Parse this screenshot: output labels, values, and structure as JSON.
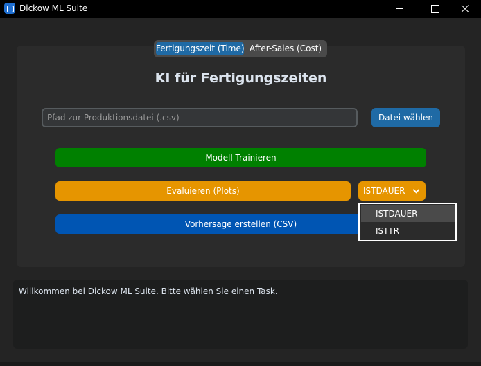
{
  "window": {
    "title": "Dickow ML Suite",
    "icon": "app-window-icon"
  },
  "tabs": [
    {
      "label": "Fertigungszeit (Time)",
      "selected": true
    },
    {
      "label": "After-Sales (Cost)",
      "selected": false
    }
  ],
  "main": {
    "title": "KI für Fertigungszeiten",
    "file_input": {
      "value": "",
      "placeholder": "Pfad zur Produktionsdatei (.csv)"
    },
    "choose_file_label": "Datei wählen",
    "train_label": "Modell Trainieren",
    "evaluate_label": "Evaluieren (Plots)",
    "predict_label": "Vorhersage erstellen (CSV)",
    "target_select": {
      "value": "ISTDAUER",
      "options": [
        "ISTDAUER",
        "ISTTR"
      ]
    }
  },
  "log": {
    "text": "Willkommen bei Dickow ML Suite. Bitte wählen Sie einen Task."
  },
  "colors": {
    "accent_blue": "#1f6aa5",
    "train_green": "#008000",
    "evaluate_orange": "#e69500",
    "predict_blue": "#0055b3"
  }
}
